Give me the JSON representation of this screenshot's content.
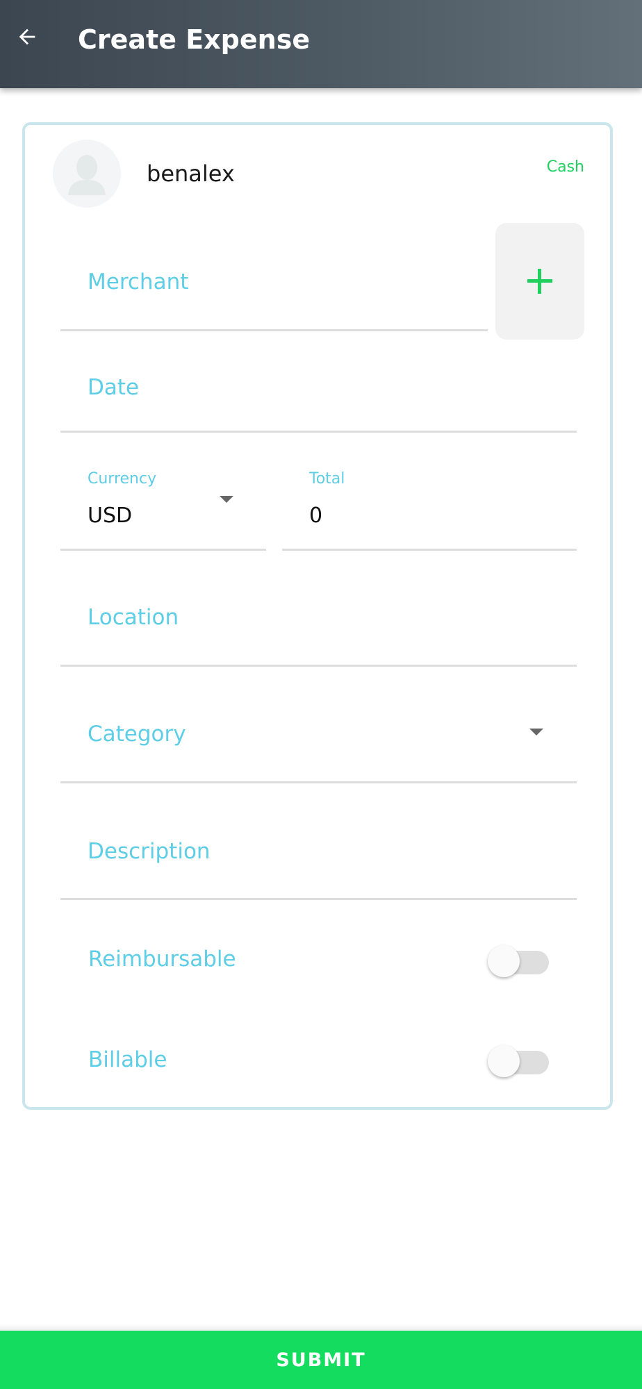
{
  "header": {
    "title": "Create Expense",
    "back_icon": "arrow-left-icon"
  },
  "user": {
    "name": "benalex",
    "avatar_icon": "person-silhouette-icon",
    "payment_type": "Cash"
  },
  "form": {
    "merchant": {
      "placeholder": "Merchant",
      "add_icon": "plus-icon"
    },
    "date": {
      "placeholder": "Date"
    },
    "currency": {
      "label": "Currency",
      "value": "USD"
    },
    "total": {
      "label": "Total",
      "value": "0"
    },
    "location": {
      "placeholder": "Location"
    },
    "category": {
      "placeholder": "Category"
    },
    "description": {
      "placeholder": "Description"
    },
    "reimbursable": {
      "label": "Reimbursable",
      "on": false
    },
    "billable": {
      "label": "Billable",
      "on": false
    }
  },
  "actions": {
    "submit_label": "SUBMIT"
  },
  "colors": {
    "accent_green": "#14dc5f",
    "label_blue": "#5ecde6",
    "header_dark": "#3c4650"
  }
}
